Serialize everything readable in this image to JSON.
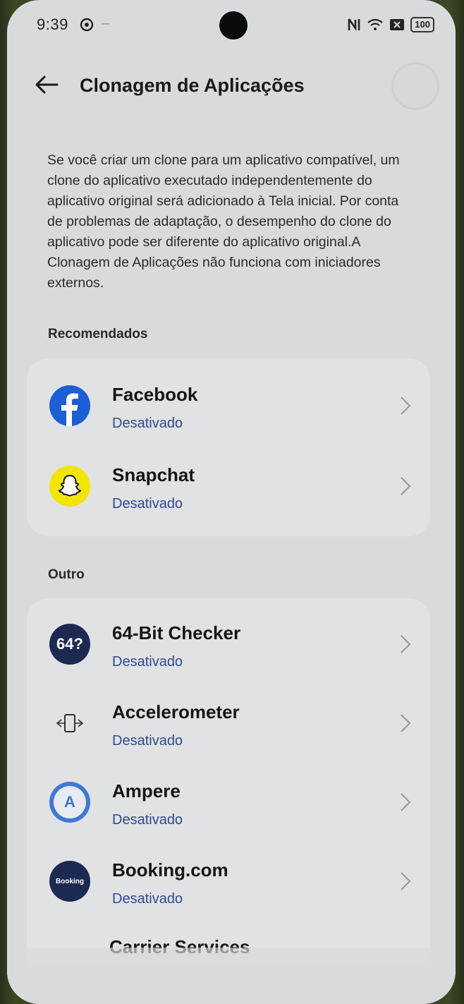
{
  "status_bar": {
    "time": "9:39",
    "battery": "100"
  },
  "header": {
    "title": "Clonagem de Aplicações"
  },
  "description": "Se você criar um clone para um aplicativo compatível, um clone do aplicativo executado independentemente do aplicativo original será adicionado à Tela inicial. Por conta de problemas de adaptação, o desempenho do clone do aplicativo pode ser diferente do aplicativo original.A Clonagem de Aplicações não funciona com iniciadores externos.",
  "sections": {
    "recommended": {
      "title": "Recomendados",
      "apps": [
        {
          "name": "Facebook",
          "status": "Desativado",
          "icon": "facebook-icon"
        },
        {
          "name": "Snapchat",
          "status": "Desativado",
          "icon": "snapchat-icon"
        }
      ]
    },
    "other": {
      "title": "Outro",
      "apps": [
        {
          "name": "64-Bit Checker",
          "status": "Desativado",
          "icon": "64bit-checker-icon",
          "icon_text": "64?"
        },
        {
          "name": "Accelerometer",
          "status": "Desativado",
          "icon": "accelerometer-icon"
        },
        {
          "name": "Ampere",
          "status": "Desativado",
          "icon": "ampere-icon",
          "icon_text": "A"
        },
        {
          "name": "Booking.com",
          "status": "Desativado",
          "icon": "booking-icon",
          "icon_text": "Booking"
        },
        {
          "name": "Carrier Services",
          "status": "",
          "icon": "carrier-services-icon"
        }
      ]
    }
  },
  "colors": {
    "status_text": "#2e4a8f",
    "facebook": "#1b5fd6",
    "snapchat": "#f2e600",
    "dark_navy": "#1c2a52"
  }
}
